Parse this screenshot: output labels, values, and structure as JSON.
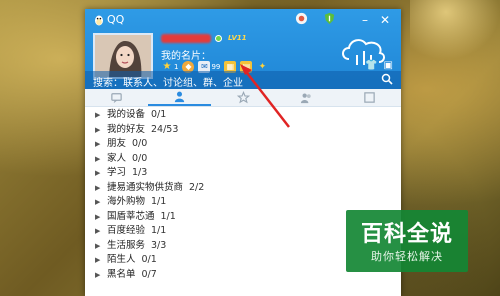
{
  "window": {
    "title": "QQ"
  },
  "profile": {
    "level_badge": "LV11",
    "signature": "我的名片：",
    "counts": {
      "star": "1",
      "mail": "99"
    }
  },
  "search": {
    "text": "搜索：联系人、讨论组、群、企业"
  },
  "groups": [
    {
      "name": "我的设备",
      "count": "0/1"
    },
    {
      "name": "我的好友",
      "count": "24/53"
    },
    {
      "name": "朋友",
      "count": "0/0"
    },
    {
      "name": "家人",
      "count": "0/0"
    },
    {
      "name": "学习",
      "count": "1/3"
    },
    {
      "name": "捷易通实物供货商",
      "count": "2/2"
    },
    {
      "name": "海外购物",
      "count": "1/1"
    },
    {
      "name": "国盾莘芯通",
      "count": "1/1"
    },
    {
      "name": "百度经验",
      "count": "1/1"
    },
    {
      "name": "生活服务",
      "count": "3/3"
    },
    {
      "name": "陌生人",
      "count": "0/1"
    },
    {
      "name": "黑名单",
      "count": "0/7"
    }
  ],
  "watermark": {
    "title": "百科全说",
    "subtitle": "助你轻松解决"
  },
  "colors": {
    "header_blue": "#2f9be6",
    "annotation_red": "#e02424",
    "watermark_green": "#148734"
  }
}
